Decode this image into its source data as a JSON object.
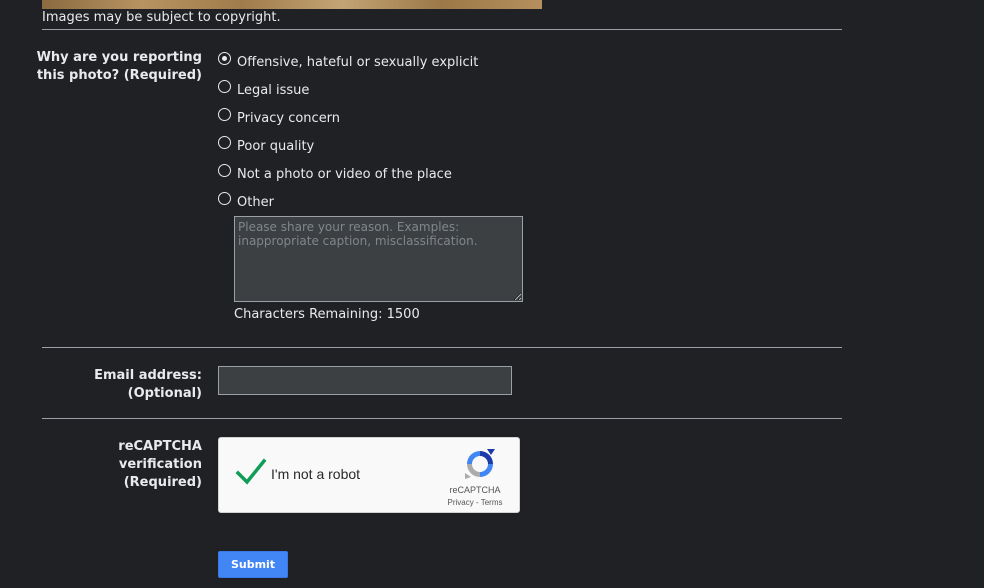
{
  "copyright_note": "Images may be subject to copyright.",
  "report": {
    "question_line1": "Why are you reporting",
    "question_line2": "this photo? (Required)",
    "options": [
      {
        "label": "Offensive, hateful or sexually explicit",
        "checked": true
      },
      {
        "label": "Legal issue",
        "checked": false
      },
      {
        "label": "Privacy concern",
        "checked": false
      },
      {
        "label": "Poor quality",
        "checked": false
      },
      {
        "label": "Not a photo or video of the place",
        "checked": false
      },
      {
        "label": "Other",
        "checked": false
      }
    ],
    "reason_placeholder": "Please share your reason. Examples: inappropriate caption, misclassification.",
    "reason_value": "",
    "chars_remaining": "Characters Remaining: 1500"
  },
  "email": {
    "label_line1": "Email address:",
    "label_line2": "(Optional)",
    "value": ""
  },
  "captcha": {
    "label_line1": "reCAPTCHA verification",
    "label_line2": "(Required)",
    "checkbox_text": "I'm not a robot",
    "checked": true,
    "brand": "reCAPTCHA",
    "links": "Privacy - Terms"
  },
  "submit_label": "Submit",
  "colors": {
    "background": "#202124",
    "text": "#e8eaed",
    "input_bg": "#3c4043",
    "submit": "#4285f4",
    "check": "#0f9d58"
  },
  "icons": {
    "radio": "radio-icon",
    "check": "checkmark-icon",
    "captcha_logo": "recaptcha-logo-icon"
  }
}
